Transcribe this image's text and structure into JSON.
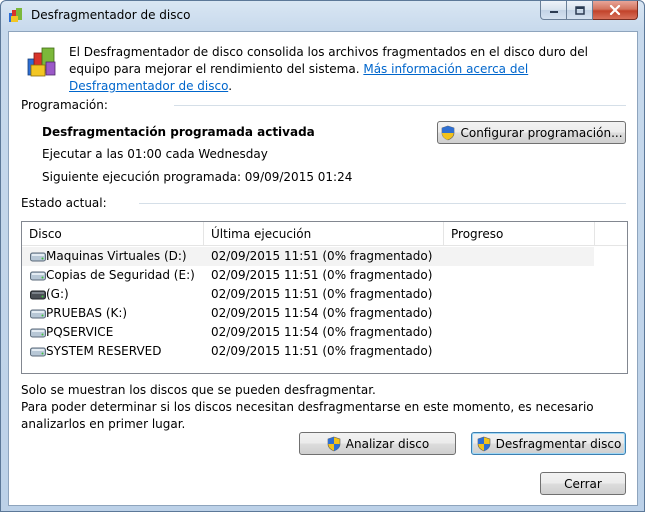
{
  "window": {
    "title": "Desfragmentador de disco"
  },
  "intro": {
    "text": "El Desfragmentador de disco consolida los archivos fragmentados en el disco duro del equipo para mejorar el rendimiento del sistema.",
    "link": "Más información acerca del Desfragmentador de disco"
  },
  "schedule": {
    "section_label": "Programación:",
    "status": "Desfragmentación programada activada",
    "run_at": "Ejecutar a las 01:00 cada Wednesday",
    "next_run": "Siguiente ejecución programada: 09/09/2015 01:24",
    "configure_button": "Configurar programación..."
  },
  "current": {
    "section_label": "Estado actual:",
    "columns": [
      "Disco",
      "Última ejecución",
      "Progreso"
    ],
    "rows": [
      {
        "disk": "Maquinas Virtuales (D:)",
        "last_run": "02/09/2015 11:51 (0% fragmentado)",
        "progress": ""
      },
      {
        "disk": "Copias de Seguridad (E:)",
        "last_run": "02/09/2015 11:51 (0% fragmentado)",
        "progress": ""
      },
      {
        "disk": "(G:)",
        "last_run": "02/09/2015 11:51 (0% fragmentado)",
        "progress": ""
      },
      {
        "disk": "PRUEBAS (K:)",
        "last_run": "02/09/2015 11:54 (0% fragmentado)",
        "progress": ""
      },
      {
        "disk": "PQSERVICE",
        "last_run": "02/09/2015 11:54 (0% fragmentado)",
        "progress": ""
      },
      {
        "disk": "SYSTEM RESERVED",
        "last_run": "02/09/2015 11:51 (0% fragmentado)",
        "progress": ""
      }
    ]
  },
  "notes": {
    "line1": "Solo se muestran los discos que se pueden desfragmentar.",
    "line2": "Para poder determinar si los discos necesitan desfragmentarse en este momento, es necesario analizarlos en primer lugar."
  },
  "buttons": {
    "analyze": "Analizar disco",
    "defragment": "Desfragmentar disco",
    "close": "Cerrar"
  },
  "colors": {
    "link": "#0066cc",
    "titlebar": "#c7d9ec",
    "close_button": "#c2432b"
  }
}
